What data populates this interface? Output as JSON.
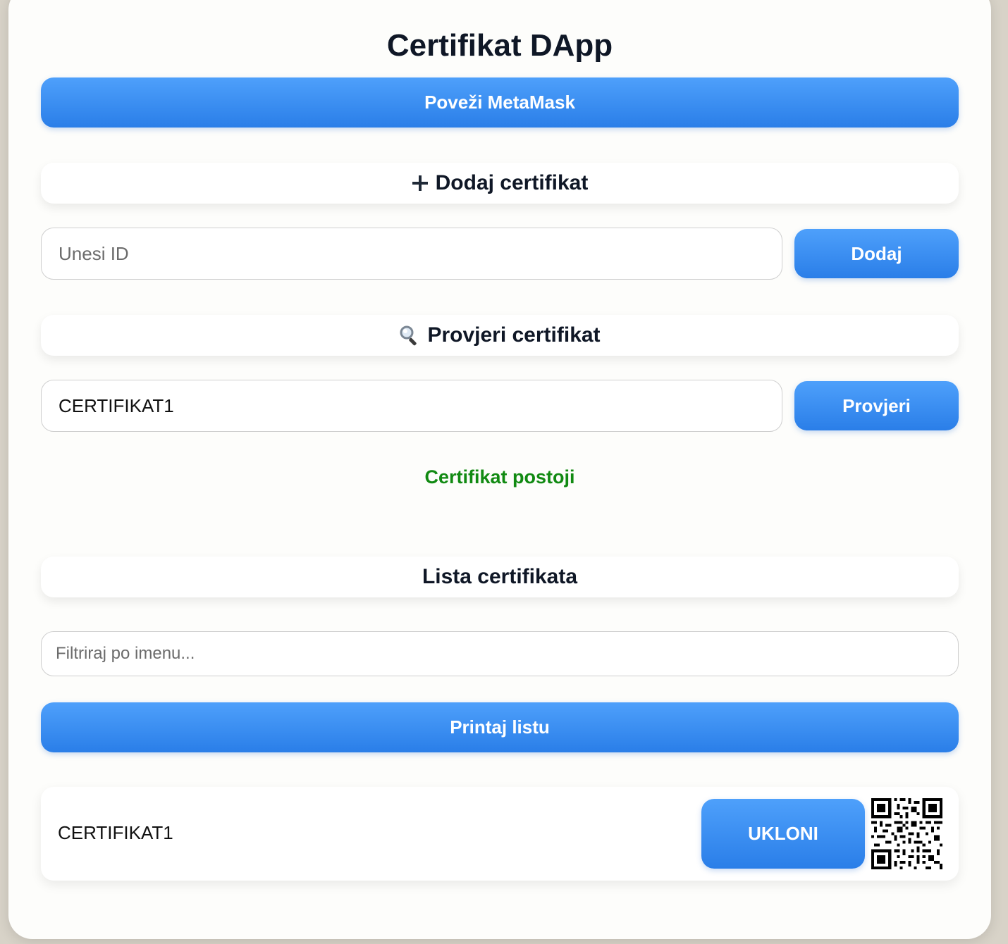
{
  "app": {
    "title": "Certifikat DApp"
  },
  "connect": {
    "label": "Poveži MetaMask"
  },
  "add_section": {
    "icon": "plus-icon",
    "heading": "Dodaj certifikat",
    "input_value": "",
    "input_placeholder": "Unesi ID",
    "button_label": "Dodaj"
  },
  "verify_section": {
    "icon": "magnifier-icon",
    "heading": "Provjeri certifikat",
    "input_value": "CERTIFIKAT1",
    "input_placeholder": "",
    "button_label": "Provjeri",
    "status": "Certifikat postoji",
    "status_color": "#118a12"
  },
  "list_section": {
    "heading": "Lista certifikata",
    "filter_placeholder": "Filtriraj po imenu...",
    "filter_value": "",
    "print_label": "Printaj listu",
    "items": [
      {
        "name": "CERTIFIKAT1",
        "remove_label": "UKLONI",
        "qr_icon": "qr-code-icon"
      }
    ]
  },
  "colors": {
    "accent_top": "#4ea0fb",
    "accent_bottom": "#2a7ee8",
    "text": "#0f1726",
    "success": "#118a12"
  }
}
